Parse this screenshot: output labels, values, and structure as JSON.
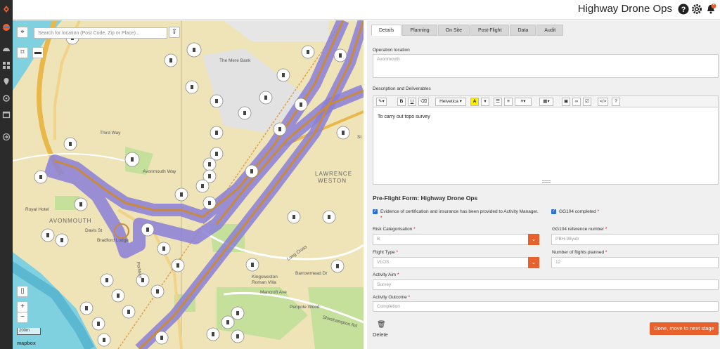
{
  "app": {
    "title": "Highway Drone Ops",
    "notification_count": "8"
  },
  "sidebar": {
    "items": [
      "drone-icon",
      "home-icon",
      "grid-icon",
      "location-icon",
      "target-icon",
      "calendar-icon",
      "logout-icon"
    ]
  },
  "map": {
    "search_placeholder": "Search for location (Post Code, Zip or Place)...",
    "labels": {
      "third_way": "Third Way",
      "avonmouth_way": "Avonmouth Way",
      "lawrence": "LAWRENCE",
      "weston": "WESTON",
      "avonmouth": "AVONMOUTH",
      "royal_hotel": "Royal Hotel",
      "the_mere_bank": "The Mere Bank",
      "davis_st": "Davis St",
      "bradford_lodge": "Bradford Lodge",
      "portway": "Portway",
      "long_cross": "Long Cross",
      "kingsweston": "Kingsweston",
      "roman_villa": "Roman Villa",
      "barracks_rd": "Barrowmead Dr",
      "mancroft_ave": "Mancroft Ave",
      "penpole_wood": "Penpole Wood",
      "shirehampton_rd": "Shirehampton Rd",
      "st": "St"
    },
    "zoom_in": "+",
    "zoom_out": "−",
    "scale": "200m",
    "attribution": "mapbox"
  },
  "tabs": [
    "Details",
    "Planning",
    "On Site",
    "Post-Flight",
    "Data",
    "Audit"
  ],
  "active_tab": "Details",
  "form": {
    "operation_location_label": "Operation location",
    "operation_location_value": "Avonmouth",
    "description_label": "Description and Deliverables",
    "toolbar": {
      "font": "Helvetica"
    },
    "description_text": "To carry out topo survey",
    "preflight_title": "Pre-Flight Form: Highway Drone Ops",
    "evidence_label": "Evidence of certification and insurance has been provided to Activity Manager.",
    "gg104_completed_label": "GG104 completed",
    "risk_label": "Risk Categorisation",
    "risk_value": "B",
    "gg104_ref_label": "GG104 reference number",
    "gg104_ref_value": "PBH-98yutr",
    "flight_type_label": "Flight Type",
    "flight_type_value": "VLOS",
    "num_flights_label": "Number of flights planned",
    "num_flights_value": "12",
    "activity_aim_label": "Activity Aim",
    "activity_aim_value": "Survey",
    "activity_outcome_label": "Activity Outcome",
    "activity_outcome_value": "Completion",
    "delete_label": "Delete",
    "done_label": "Done, move to next stage"
  },
  "colors": {
    "accent": "#e8602c",
    "sidebar": "#2b2b2b",
    "route": "#8a7fd8"
  }
}
